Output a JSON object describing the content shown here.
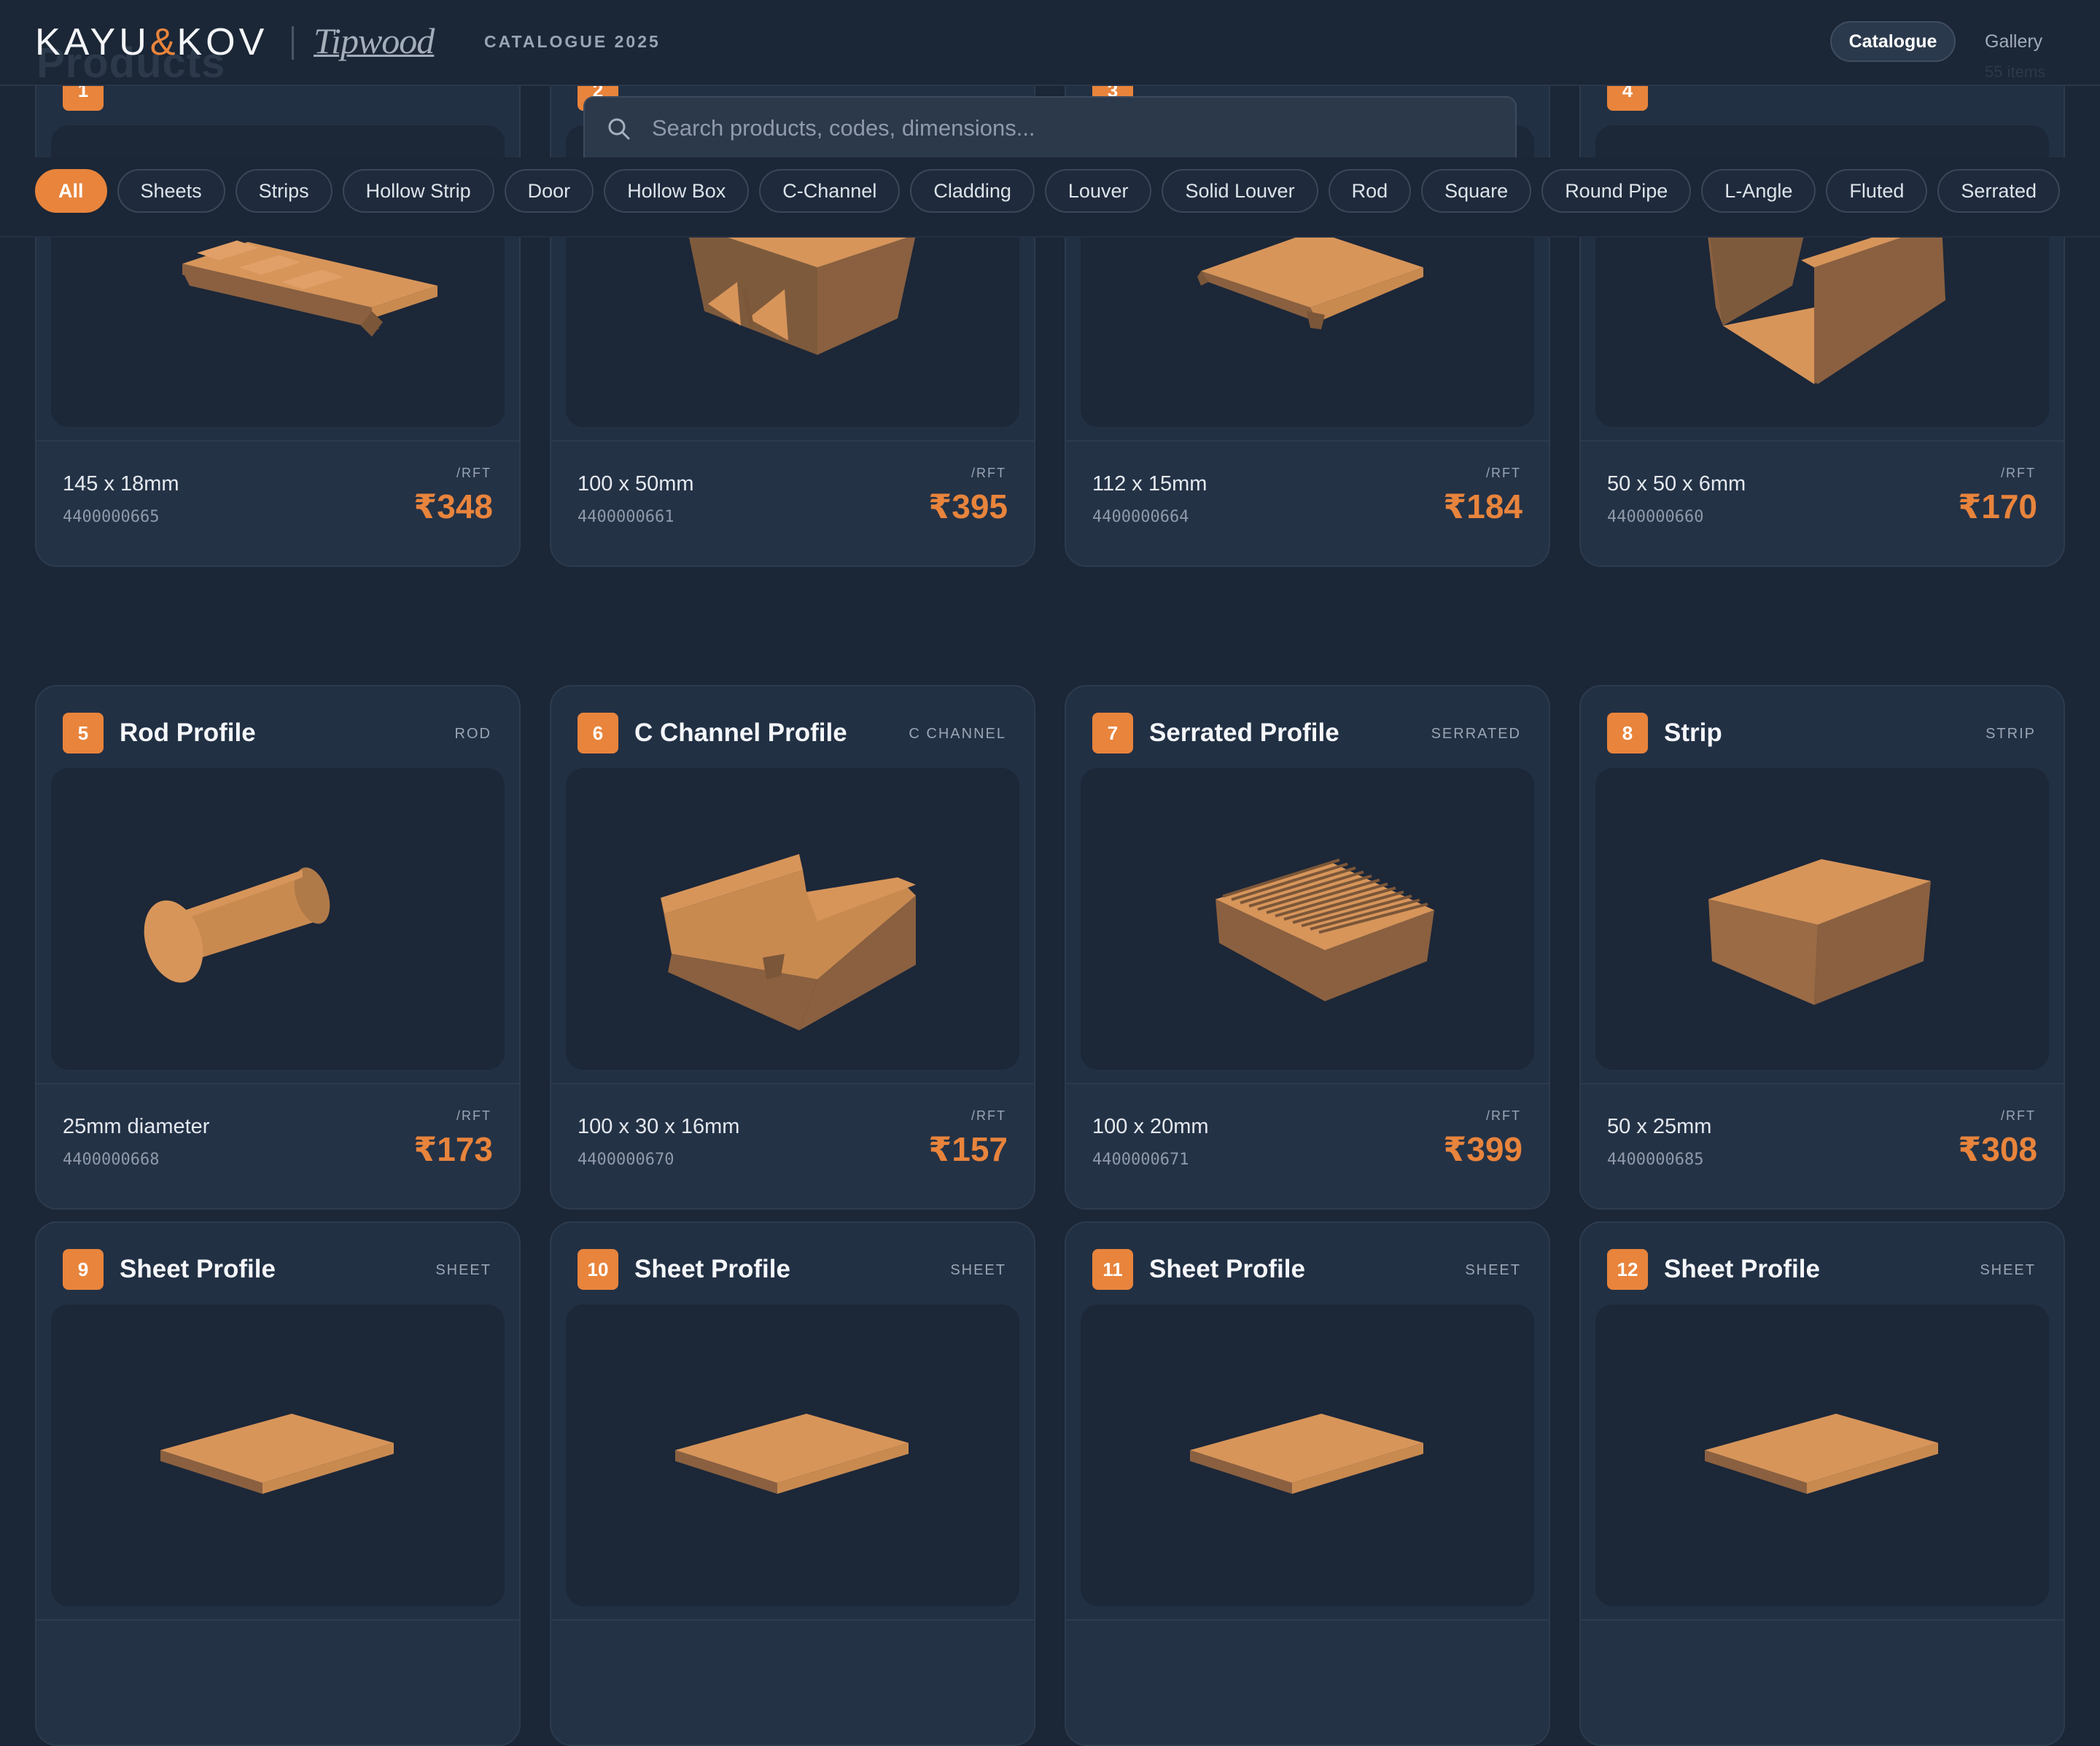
{
  "header": {
    "ghost_title": "Products",
    "brand_primary_left": "KAYU",
    "brand_primary_amp": "&",
    "brand_primary_right": "KOV",
    "brand_secondary": "Tipwood",
    "catalogue_label": "CATALOGUE 2025",
    "nav_active": "Catalogue",
    "nav_other": "Gallery",
    "nav_ghost": "55 items"
  },
  "search": {
    "placeholder": "Search products, codes, dimensions..."
  },
  "filters": [
    "All",
    "Sheets",
    "Strips",
    "Hollow Strip",
    "Door",
    "Hollow Box",
    "C-Channel",
    "Cladding",
    "Louver",
    "Solid Louver",
    "Rod",
    "Square",
    "Round Pipe",
    "L-Angle",
    "Fluted",
    "Serrated"
  ],
  "active_filter": "All",
  "colors": {
    "accent": "#e8843c",
    "background": "#1b2636",
    "card": "#223044"
  },
  "products": [
    {
      "num": "1",
      "title": "",
      "category": "",
      "dims": "145 x 18mm",
      "code": "4400000665",
      "unit": "/RFT",
      "price": "₹348",
      "shape": "cladding"
    },
    {
      "num": "2",
      "title": "",
      "category": "",
      "dims": "100 x 50mm",
      "code": "4400000661",
      "unit": "/RFT",
      "price": "₹395",
      "shape": "hollow-box"
    },
    {
      "num": "3",
      "title": "",
      "category": "",
      "dims": "112 x 15mm",
      "code": "4400000664",
      "unit": "/RFT",
      "price": "₹184",
      "shape": "louver"
    },
    {
      "num": "4",
      "title": "",
      "category": "",
      "dims": "50 x 50 x 6mm",
      "code": "4400000660",
      "unit": "/RFT",
      "price": "₹170",
      "shape": "channel-tall"
    },
    {
      "num": "5",
      "title": "Rod Profile",
      "category": "ROD",
      "dims": "25mm diameter",
      "code": "4400000668",
      "unit": "/RFT",
      "price": "₹173",
      "shape": "rod"
    },
    {
      "num": "6",
      "title": "C Channel Profile",
      "category": "C CHANNEL",
      "dims": "100 x 30 x 16mm",
      "code": "4400000670",
      "unit": "/RFT",
      "price": "₹157",
      "shape": "c-channel"
    },
    {
      "num": "7",
      "title": "Serrated Profile",
      "category": "SERRATED",
      "dims": "100 x 20mm",
      "code": "4400000671",
      "unit": "/RFT",
      "price": "₹399",
      "shape": "serrated"
    },
    {
      "num": "8",
      "title": "Strip",
      "category": "STRIP",
      "dims": "50 x 25mm",
      "code": "4400000685",
      "unit": "/RFT",
      "price": "₹308",
      "shape": "strip"
    },
    {
      "num": "9",
      "title": "Sheet Profile",
      "category": "SHEET",
      "dims": "",
      "code": "",
      "unit": "",
      "price": "",
      "shape": "sheet"
    },
    {
      "num": "10",
      "title": "Sheet Profile",
      "category": "SHEET",
      "dims": "",
      "code": "",
      "unit": "",
      "price": "",
      "shape": "sheet"
    },
    {
      "num": "11",
      "title": "Sheet Profile",
      "category": "SHEET",
      "dims": "",
      "code": "",
      "unit": "",
      "price": "",
      "shape": "sheet"
    },
    {
      "num": "12",
      "title": "Sheet Profile",
      "category": "SHEET",
      "dims": "",
      "code": "",
      "unit": "",
      "price": "",
      "shape": "sheet"
    }
  ]
}
